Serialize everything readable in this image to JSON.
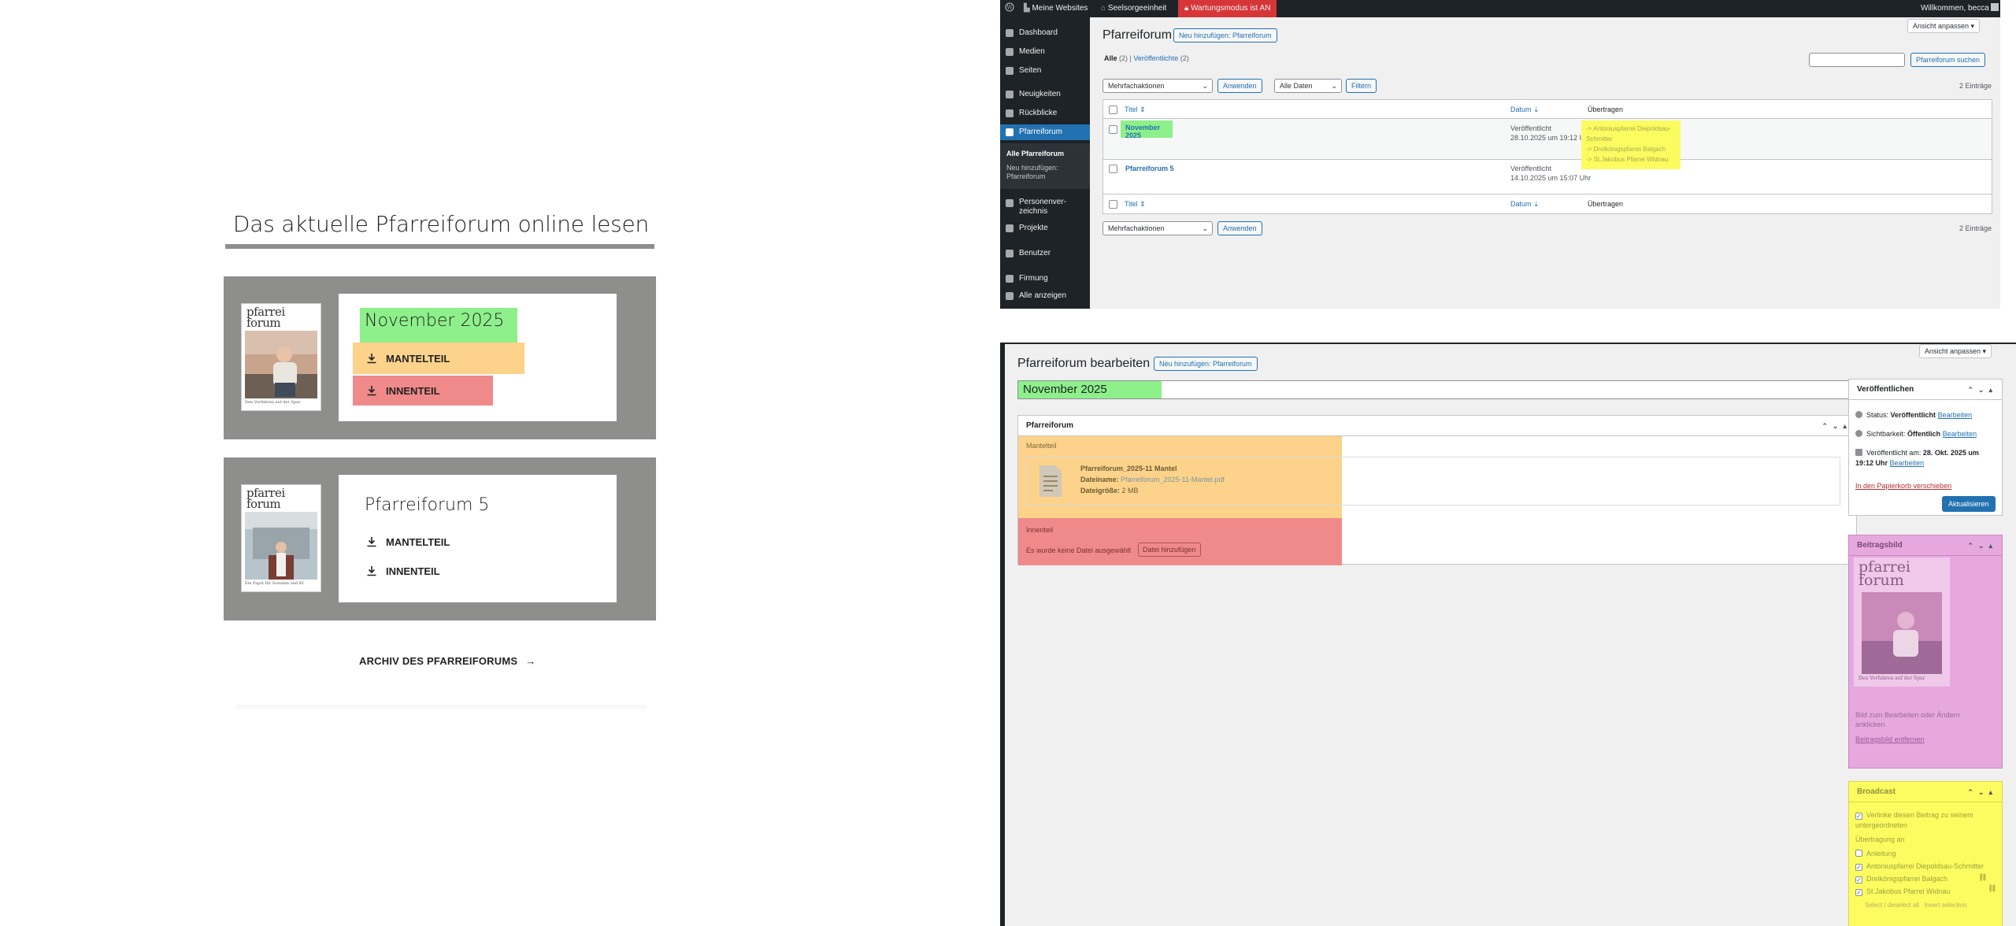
{
  "colors": {
    "highlight_green": "#8ef08a",
    "highlight_orange": "#fdd28a",
    "highlight_red": "#f08a8a",
    "highlight_yellow": "#fcfc60",
    "highlight_magenta": "#e7a8e0",
    "wp_dark": "#1d2327",
    "wp_blue": "#2271b1",
    "card_gray": "#8e8e8c"
  },
  "frontend": {
    "section_title": "Das aktuelle Pfarreiforum online lesen",
    "issues": [
      {
        "name": "November 2025",
        "cover_logo_line1": "pfarrei",
        "cover_logo_line2": "forum",
        "cover_tagline": "Den Vorfahren auf der Spur",
        "downloads": [
          {
            "label": "MANTELTEIL",
            "icon": "download-icon"
          },
          {
            "label": "INNENTEIL",
            "icon": "download-icon"
          }
        ]
      },
      {
        "name": "Pfarreiforum 5",
        "cover_logo_line1": "pfarrei",
        "cover_logo_line2": "forum",
        "cover_tagline": "Ein Papst für Sozialen und KI",
        "downloads": [
          {
            "label": "MANTELTEIL",
            "icon": "download-icon"
          },
          {
            "label": "INNENTEIL",
            "icon": "download-icon"
          }
        ]
      }
    ],
    "archive_link": "ARCHIV DES PFARREIFORUMS",
    "archive_arrow": "→"
  },
  "admin_bar": {
    "wp_logo": "wordpress-icon",
    "my_sites": "Meine Websites",
    "site_name": "Seelsorgeeinheit",
    "maintenance": "Wartungsmodus ist AN",
    "greeting": "Willkommen, becca"
  },
  "admin_menu": {
    "items": [
      {
        "label": "Dashboard",
        "icon": "dashboard-icon"
      },
      {
        "label": "Medien",
        "icon": "media-icon"
      },
      {
        "label": "Seiten",
        "icon": "pages-icon"
      },
      {
        "label": "Neuigkeiten",
        "icon": "pin-icon"
      },
      {
        "label": "Rückblicke",
        "icon": "pin-icon"
      },
      {
        "label": "Pfarreiforum",
        "icon": "pages-icon"
      },
      {
        "label": "Personenver-\nzeichnis",
        "icon": "users-icon"
      },
      {
        "label": "Projekte",
        "icon": "pin-icon"
      },
      {
        "label": "Benutzer",
        "icon": "users-icon"
      },
      {
        "label": "Firmung",
        "icon": "pin-icon"
      },
      {
        "label": "Alle anzeigen",
        "icon": "chevron-icon"
      }
    ],
    "submenu": {
      "all": "Alle Pfarreiforum",
      "add_new": "Neu hinzufügen:\nPfarreiforum"
    }
  },
  "list_screen": {
    "title": "Pfarreiforum",
    "add_new": "Neu hinzufügen: Pfarreiforum",
    "screen_options": "Ansicht anpassen ▾",
    "filter_all": "Alle",
    "filter_all_count": "(2)",
    "filter_sep": "|",
    "filter_published": "Veröffentlichte",
    "filter_published_count": "(2)",
    "search_button": "Pfarreiforum suchen",
    "search_value": "",
    "bulk_action": "Mehrfachaktionen",
    "apply": "Anwenden",
    "date_filter": "Alle Daten",
    "filter_button": "Filtern",
    "count_label": "2 Einträge",
    "columns": {
      "title": "Titel ⇕",
      "date": "Datum ⇣",
      "broadcast": "Übertragen"
    },
    "rows": [
      {
        "title": "November 2025",
        "status": "Veröffentlicht",
        "date": "28.10.2025 um 19:12 Uhr",
        "broadcast": [
          "-> Antoniuspfarrei Diepoldsau-Schmitter",
          "-> Dreikönigspfarrei Balgach",
          "-> St.Jakobus Pfarrei Widnau"
        ]
      },
      {
        "title": "Pfarreiforum 5",
        "status": "Veröffentlicht",
        "date": "14.10.2025 um 15:07 Uhr",
        "broadcast": []
      }
    ]
  },
  "edit_screen": {
    "title": "Pfarreiforum bearbeiten",
    "add_new": "Neu hinzufügen: Pfarreiforum",
    "screen_options": "Ansicht anpassen ▾",
    "post_title": "November 2025",
    "metabox_title": "Pfarreiforum",
    "mantelteil_label": "Mantelteil",
    "file_title": "Pfarreiforum_2025-11 Mantel",
    "file_name_label": "Dateiname:",
    "file_name": "Pfarreiforum_2025-11-Mantel.pdf",
    "file_size_label": "Dateigröße:",
    "file_size": "2 MB",
    "innenteil_label": "Innenteil",
    "no_file": "Es wurde keine Datei ausgewählt",
    "add_file": "Datei hinzufügen",
    "publish_box": {
      "title": "Veröffentlichen",
      "status_label": "Status:",
      "status": "Veröffentlicht",
      "visibility_label": "Sichtbarkeit:",
      "visibility": "Öffentlich",
      "published_on_label": "Veröffentlicht am:",
      "published_on": "28. Okt. 2025 um",
      "published_time": "19:12 Uhr",
      "edit": "Bearbeiten",
      "trash": "In den Papierkorb verschieben",
      "update": "Aktualisieren"
    },
    "featured_image_box": {
      "title": "Beitragsbild",
      "hint": "Bild zum Bearbeiten oder Ändern anklicken",
      "remove": "Beitragsbild entfernen"
    },
    "broadcast_box": {
      "title": "Broadcast",
      "link_option": "Verlinke diesen Beitrag zu seinem untergeordneten",
      "broadcast_to": "Übertragung an",
      "targets": [
        {
          "label": "Anleitung",
          "checked": false
        },
        {
          "label": "Antoniuspfarrei Diepoldsau-Schmitter",
          "checked": true
        },
        {
          "label": "Dreikönigspfarrei Balgach",
          "checked": true
        },
        {
          "label": "St.Jakobus Pfarrei Widnau",
          "checked": true
        }
      ],
      "select_deselect": "Select / deselect all",
      "invert": "Invert selection"
    }
  }
}
